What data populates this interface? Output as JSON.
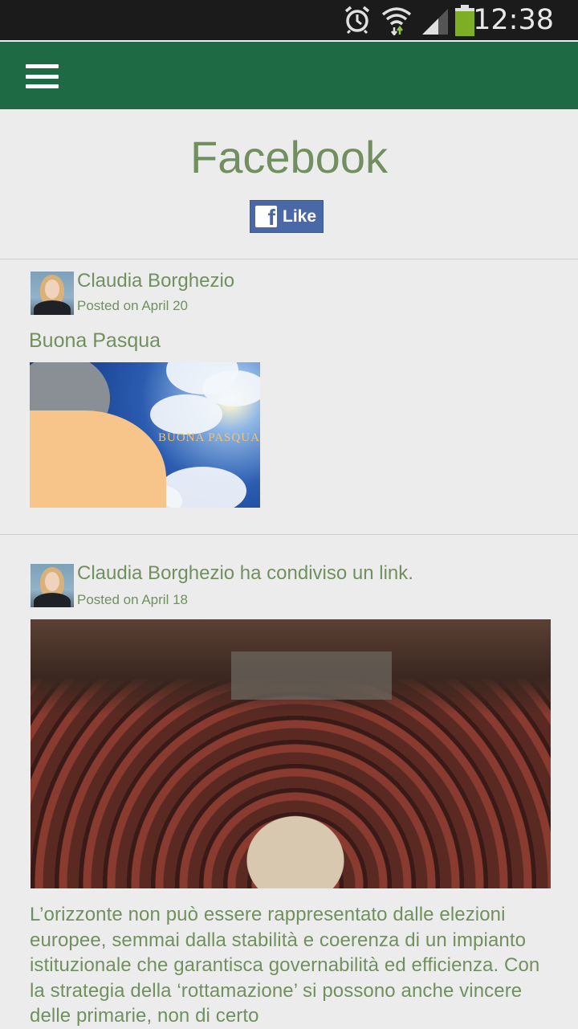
{
  "status_bar": {
    "time": "12:38",
    "icons": [
      "alarm-icon",
      "wifi-icon",
      "signal-icon",
      "battery-icon"
    ]
  },
  "app_bar": {
    "menu_icon": "hamburger-menu-icon",
    "color": "#1d6a44"
  },
  "page": {
    "title": "Facebook",
    "like_button": {
      "label": "Like",
      "icon": "facebook-f-icon",
      "color": "#4b68a6"
    }
  },
  "posts": [
    {
      "author": "Claudia Borghezio",
      "posted": "Posted on April 20",
      "heading": "Buona Pasqua",
      "image_text": "BUONA PASQUA"
    },
    {
      "author": "Claudia Borghezio ha condiviso un link.",
      "posted": "Posted on April 18",
      "body": "L’orizzonte non può essere rappresentato dalle elezioni europee, semmai dalla stabilità e coerenza di un impianto istituzionale che garantisca governabilità ed efficienza. Con la strategia della ‘rottamazione’ si possono anche vincere delle primarie, non di certo"
    }
  ],
  "colors": {
    "text_accent": "#72905f",
    "background": "#ececec"
  }
}
